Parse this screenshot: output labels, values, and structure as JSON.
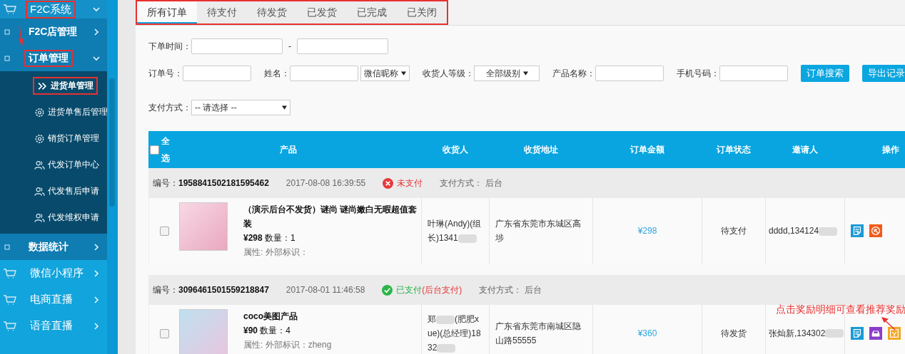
{
  "sidebar": {
    "items": [
      {
        "label": "F2C系统",
        "expanded": true,
        "highlighted": true,
        "children": [
          {
            "label": "F2C店管理",
            "expanded": false,
            "highlighted": false
          },
          {
            "label": "订单管理",
            "expanded": true,
            "highlighted": true,
            "children": [
              {
                "label": "进货单管理",
                "kind": "chevrons",
                "selected": true,
                "highlighted": true
              },
              {
                "label": "进货单售后管理",
                "kind": "gear",
                "selected": false,
                "highlighted": false
              },
              {
                "label": "销货订单管理",
                "kind": "gear",
                "selected": false,
                "highlighted": false
              },
              {
                "label": "代发订单中心",
                "kind": "users",
                "selected": false,
                "highlighted": false
              },
              {
                "label": "代发售后申请",
                "kind": "users",
                "selected": false,
                "highlighted": false
              },
              {
                "label": "代发维权申请",
                "kind": "users",
                "selected": false,
                "highlighted": false
              }
            ]
          },
          {
            "label": "数据统计",
            "expanded": false,
            "highlighted": false
          }
        ]
      },
      {
        "label": "微信小程序",
        "expanded": false,
        "highlighted": false
      },
      {
        "label": "电商直播",
        "expanded": false,
        "highlighted": false
      },
      {
        "label": "语音直播",
        "expanded": false,
        "highlighted": false
      }
    ]
  },
  "tabs_highlighted": true,
  "tabs": [
    {
      "label": "所有订单",
      "selected": true
    },
    {
      "label": "待支付",
      "selected": false
    },
    {
      "label": "待发货",
      "selected": false
    },
    {
      "label": "已发货",
      "selected": false
    },
    {
      "label": "已完成",
      "selected": false
    },
    {
      "label": "已关闭",
      "selected": false
    }
  ],
  "filter_rows": [
    {
      "fields": [
        {
          "kind": "range",
          "label": "下单时间：",
          "separator": "-"
        }
      ]
    },
    {
      "fields": [
        {
          "kind": "text",
          "label": "订单号："
        },
        {
          "kind": "text_select",
          "label": "姓名：",
          "value": "微信昵称"
        },
        {
          "kind": "select",
          "label": "收货人等级：",
          "value": "全部级别"
        },
        {
          "kind": "text",
          "label": "产品名称："
        },
        {
          "kind": "text",
          "label": "手机号码："
        },
        {
          "kind": "button",
          "label": "订单搜索"
        },
        {
          "kind": "button",
          "label": "导出记录"
        }
      ]
    },
    {
      "fields": [
        {
          "kind": "select",
          "label": "支付方式：",
          "value": "-- 请选择 --"
        }
      ]
    }
  ],
  "table": {
    "select_all": {
      "label": "全选",
      "checked": false
    },
    "columns": [
      "产品",
      "收货人",
      "收货地址",
      "订单金额",
      "订单状态",
      "邀请人",
      "操作"
    ],
    "orders": [
      {
        "number_label": "编号：",
        "number": "1958841502181595462",
        "time": "2017-08-08 16:39:55",
        "payment": {
          "kind": "unpaid",
          "text": "未支付"
        },
        "method": "支付方式：  后台",
        "checked": false,
        "product": {
          "name": "（演示后台不发货）谜尚 谜尚嫩白无暇超值套装",
          "price": "¥298",
          "quantity": "数量：1",
          "attributes": "属性: 外部标识："
        },
        "receiver_parts": [
          "叶琳(Andy)(组长)1341"
        ],
        "address": "广东省东莞市东城区高埗",
        "amount": "¥298",
        "status": "待支付",
        "inviter": "dddd,134124",
        "actions": [
          {
            "kind": "detail"
          },
          {
            "kind": "cancel"
          }
        ]
      },
      {
        "number_label": "编号：",
        "number": "3096461501559218847",
        "time": "2017-08-01 11:46:58",
        "payment": {
          "kind": "paid",
          "text": "已支付",
          "note": "(后台支付)"
        },
        "method": "支付方式：  后台",
        "checked": false,
        "product": {
          "name": "coco美图产品",
          "price": "¥90",
          "quantity": "数量：4",
          "attributes": "属性: 外部标识：zheng"
        },
        "receiver_parts": [
          "郑",
          "(肥肥xue)(总经理)1832"
        ],
        "address": "广东省东莞市南城区隐山路55555",
        "amount": "¥360",
        "status": "待发货",
        "inviter": "张灿新,134302",
        "actions": [
          {
            "kind": "detail"
          },
          {
            "kind": "ship"
          },
          {
            "kind": "reward"
          }
        ],
        "callout": "点击奖励明细可查看推荐奖励"
      }
    ]
  }
}
